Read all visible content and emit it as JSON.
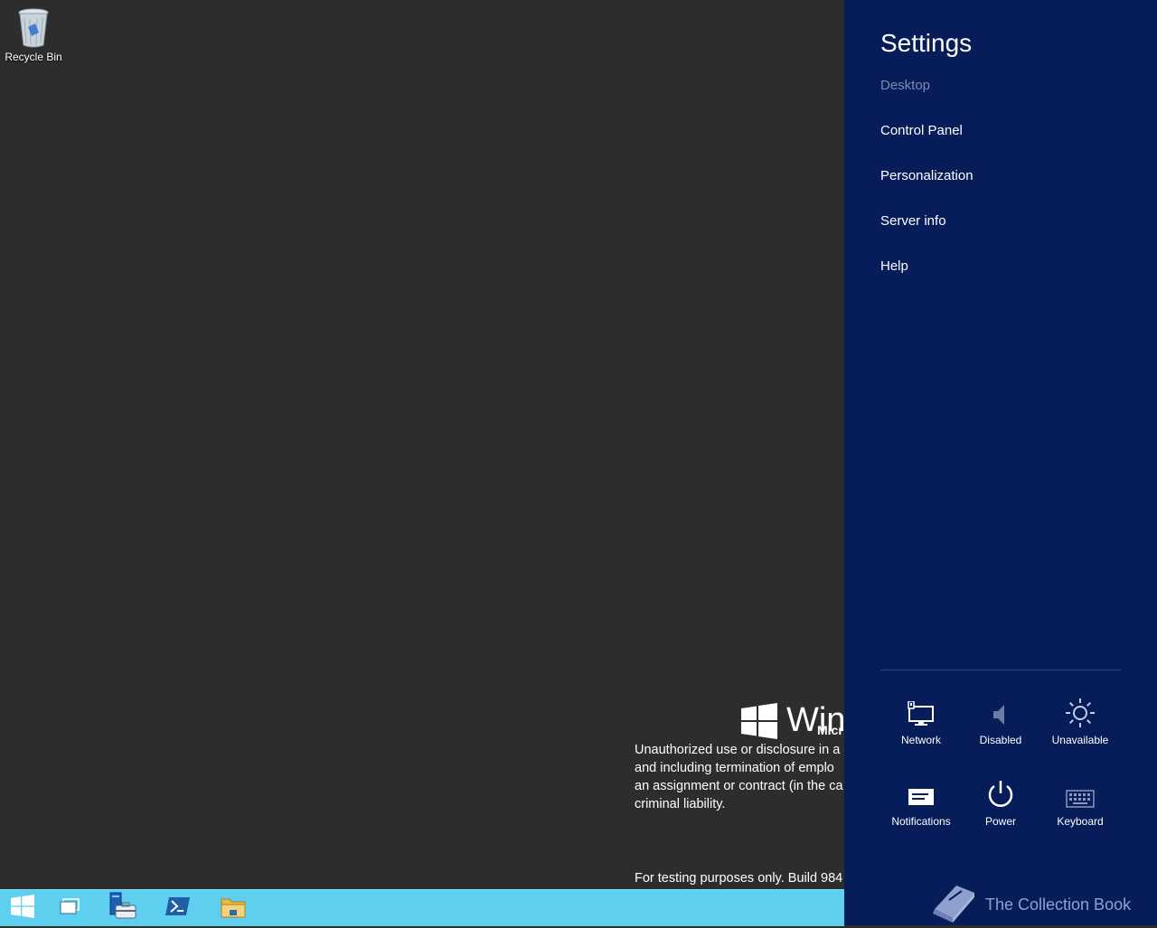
{
  "desktop": {
    "recycle_bin_label": "Recycle Bin",
    "watermark": {
      "brand_text": "Wind",
      "sub_text": "Micr",
      "legal_lines": [
        "Unauthorized use or disclosure in a",
        "and including termination of emplo",
        "an assignment or contract (in the ca",
        "criminal liability."
      ],
      "testing_text": "For testing purposes only. Build 984"
    }
  },
  "taskbar": {
    "background": "#5ecfef",
    "items": [
      "start-icon",
      "task-view-icon",
      "server-manager-icon",
      "powershell-icon",
      "file-explorer-icon"
    ]
  },
  "settings": {
    "title": "Settings",
    "context": "Desktop",
    "links": [
      "Control Panel",
      "Personalization",
      "Server info",
      "Help"
    ],
    "tiles": [
      {
        "label": "Network",
        "icon": "network-icon"
      },
      {
        "label": "Disabled",
        "icon": "volume-icon"
      },
      {
        "label": "Unavailable",
        "icon": "brightness-icon"
      },
      {
        "label": "Notifications",
        "icon": "notifications-icon"
      },
      {
        "label": "Power",
        "icon": "power-icon"
      },
      {
        "label": "Keyboard",
        "icon": "keyboard-icon"
      }
    ],
    "background": "#061d59"
  },
  "overlay": {
    "brand_text": "The Collection Book",
    "icon": "book-icon"
  }
}
